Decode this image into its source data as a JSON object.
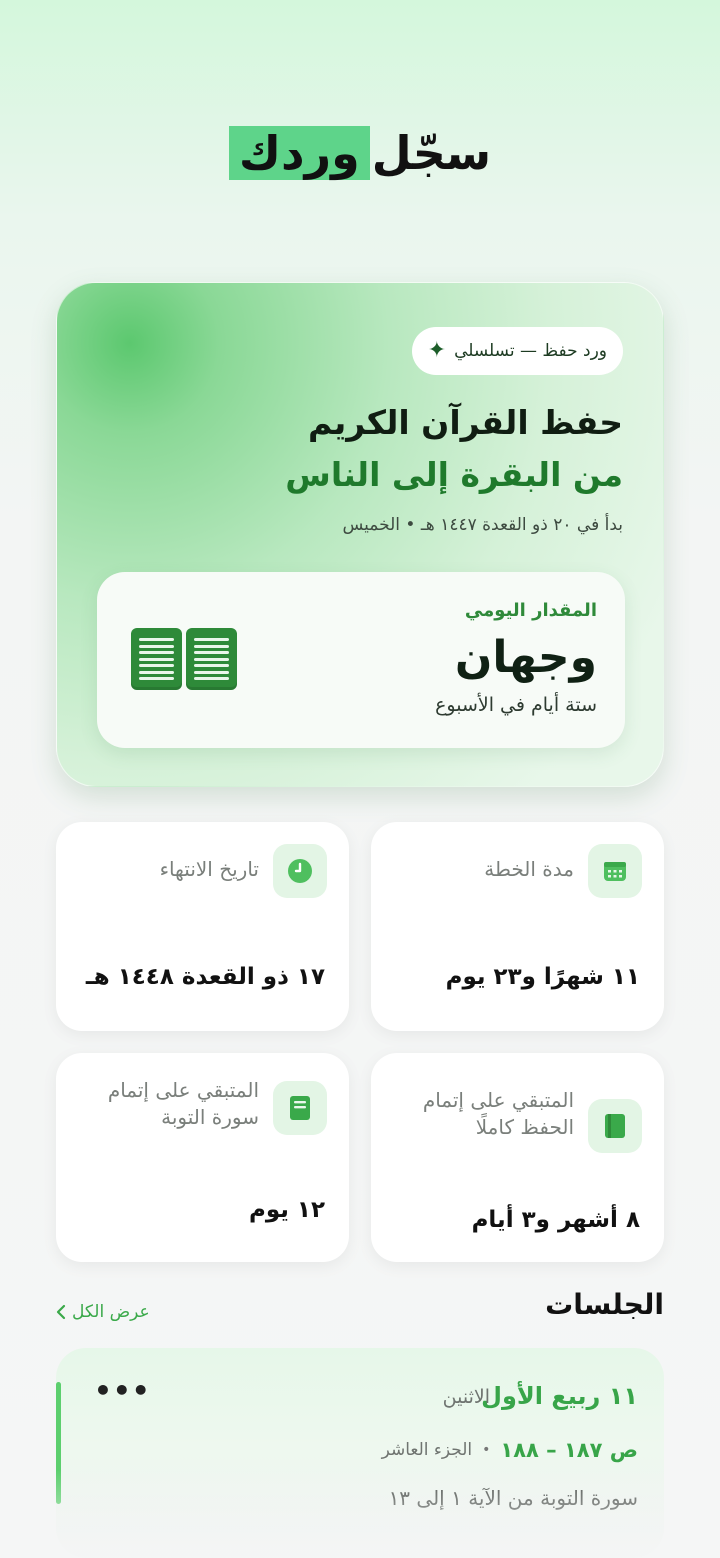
{
  "header": {
    "title_part1": "سجّل",
    "title_part2": "وردك"
  },
  "plan": {
    "badge": "ورد حفظ — تسلسلي",
    "title": "حفظ القرآن الكريم",
    "range": "من البقرة إلى الناس",
    "started": "بدأ في ٢٠ ذو القعدة ١٤٤٧ هـ • الخميس",
    "daily": {
      "label": "المقدار اليومي",
      "value": "وجهان",
      "note": "ستة أيام في الأسبوع",
      "icon": "open-book-icon"
    }
  },
  "stats": [
    {
      "label": "مدة الخطة",
      "value": "١١ شهرًا و٢٣ يوم",
      "icon": "calendar-icon"
    },
    {
      "label": "تاريخ الانتهاء",
      "value": "١٧ ذو القعدة ١٤٤٨ هـ",
      "icon": "clock-icon"
    },
    {
      "label": "المتبقي على إتمام الحفظ كاملًا",
      "value": "٨ أشهر و٣ أيام",
      "icon": "book-icon"
    },
    {
      "label": "المتبقي على إتمام سورة التوبة",
      "value": "١٢ يوم",
      "icon": "book-icon"
    }
  ],
  "sessions": {
    "title": "الجلسات",
    "view_all": "عرض الكل",
    "items": [
      {
        "date": "١١ ربيع الأول",
        "day": "الاثنين",
        "pages": "ص ١٨٧ – ١٨٨",
        "juz": "الجزء العاشر",
        "description": "سورة التوبة من الآية ١ إلى ١٣"
      }
    ]
  },
  "colors": {
    "accent": "#3aa94a",
    "accent_dark": "#1f7a2c",
    "highlight": "#5ed48a",
    "icon_bg": "#e3f5e5"
  }
}
